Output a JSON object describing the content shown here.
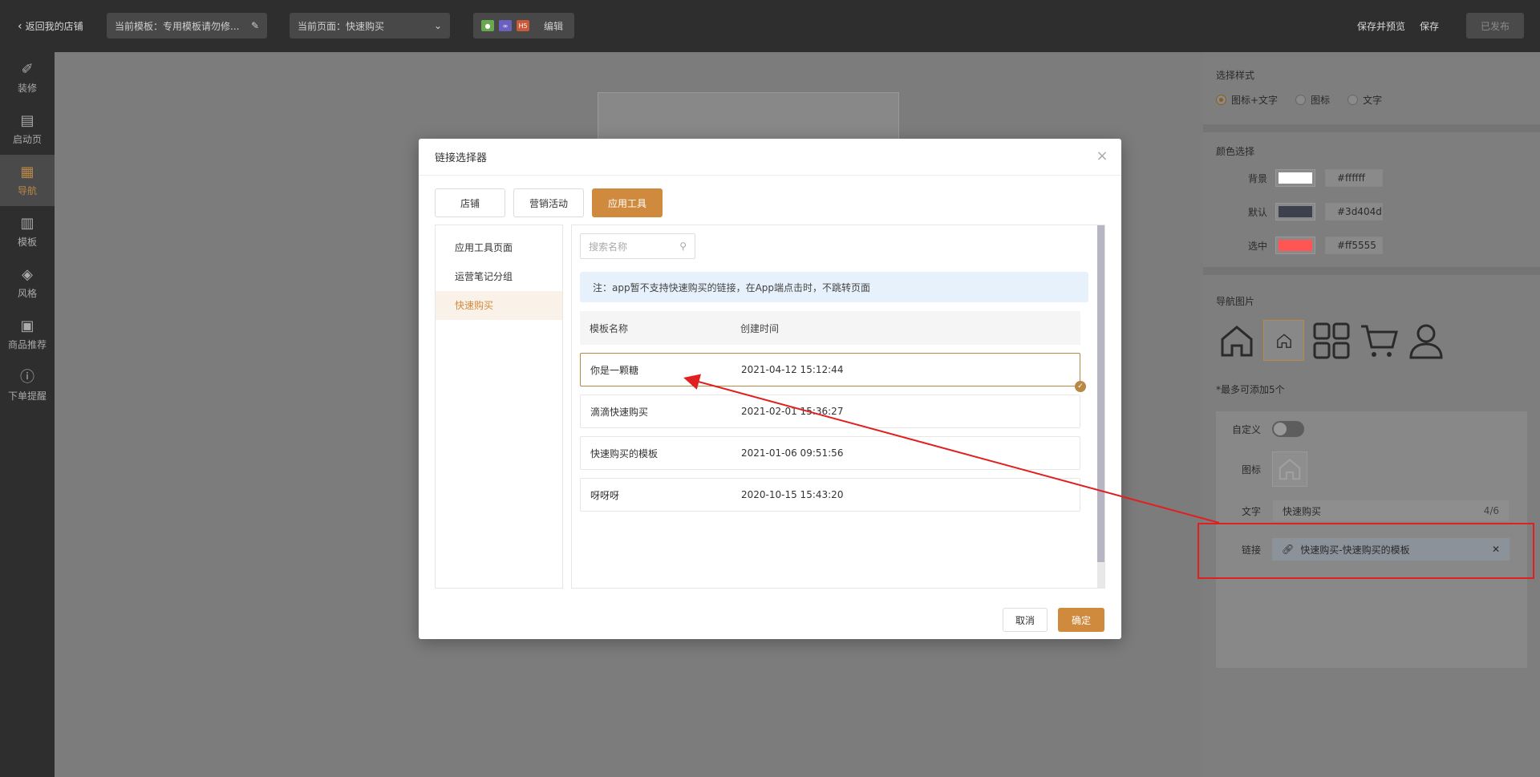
{
  "topbar": {
    "back_label": "返回我的店铺",
    "template_label": "当前模板：专用模板请勿修...",
    "page_label": "当前页面：快速购买",
    "platforms_edit": "编辑",
    "save_preview": "保存并预览",
    "save": "保存",
    "publish": "已发布"
  },
  "leftnav": {
    "items": [
      {
        "label": "装修",
        "icon": "brush-icon"
      },
      {
        "label": "启动页",
        "icon": "page-icon"
      },
      {
        "label": "导航",
        "icon": "grid-icon"
      },
      {
        "label": "模板",
        "icon": "template-icon"
      },
      {
        "label": "风格",
        "icon": "paint-bucket-icon"
      },
      {
        "label": "商品推荐",
        "icon": "goods-icon"
      },
      {
        "label": "下单提醒",
        "icon": "alert-icon"
      }
    ],
    "active_index": 2
  },
  "rightpanel": {
    "style_title": "选择样式",
    "style_options": [
      "图标+文字",
      "图标",
      "文字"
    ],
    "style_selected": "图标+文字",
    "color_title": "颜色选择",
    "colors": [
      {
        "label": "背景",
        "hex": "#ffffff"
      },
      {
        "label": "默认",
        "hex": "#3d404d"
      },
      {
        "label": "选中",
        "hex": "#ff5555"
      }
    ],
    "navimg_title": "导航图片",
    "navimg_icons": [
      "home-icon",
      "home-small-icon",
      "grid-icon",
      "cart-icon",
      "user-icon"
    ],
    "max_note": "*最多可添加5个",
    "custom_label": "自定义",
    "icon_label": "图标",
    "text_label": "文字",
    "text_value": "快速购买",
    "text_count": "4/6",
    "link_label": "链接",
    "link_value": "快速购买-快速购买的模板"
  },
  "modal": {
    "title": "链接选择器",
    "tabs": [
      "店铺",
      "营销活动",
      "应用工具"
    ],
    "active_tab": "应用工具",
    "side_items": [
      "应用工具页面",
      "运营笔记分组",
      "快速购买"
    ],
    "side_active": "快速购买",
    "search_placeholder": "搜索名称",
    "notice": "注：app暂不支持快速购买的链接，在App端点击时，不跳转页面",
    "columns": [
      "模板名称",
      "创建时间"
    ],
    "rows": [
      {
        "name": "你是一颗糖",
        "time": "2021-04-12 15:12:44"
      },
      {
        "name": "滴滴快速购买",
        "time": "2021-02-01 15:36:27"
      },
      {
        "name": "快速购买的模板",
        "time": "2021-01-06 09:51:56"
      },
      {
        "name": "呀呀呀",
        "time": "2020-10-15 15:43:20"
      }
    ],
    "selected_row": 0,
    "cancel": "取消",
    "confirm": "确定"
  },
  "accent_color": "#d08a3e",
  "annotation_color": "#e02020"
}
